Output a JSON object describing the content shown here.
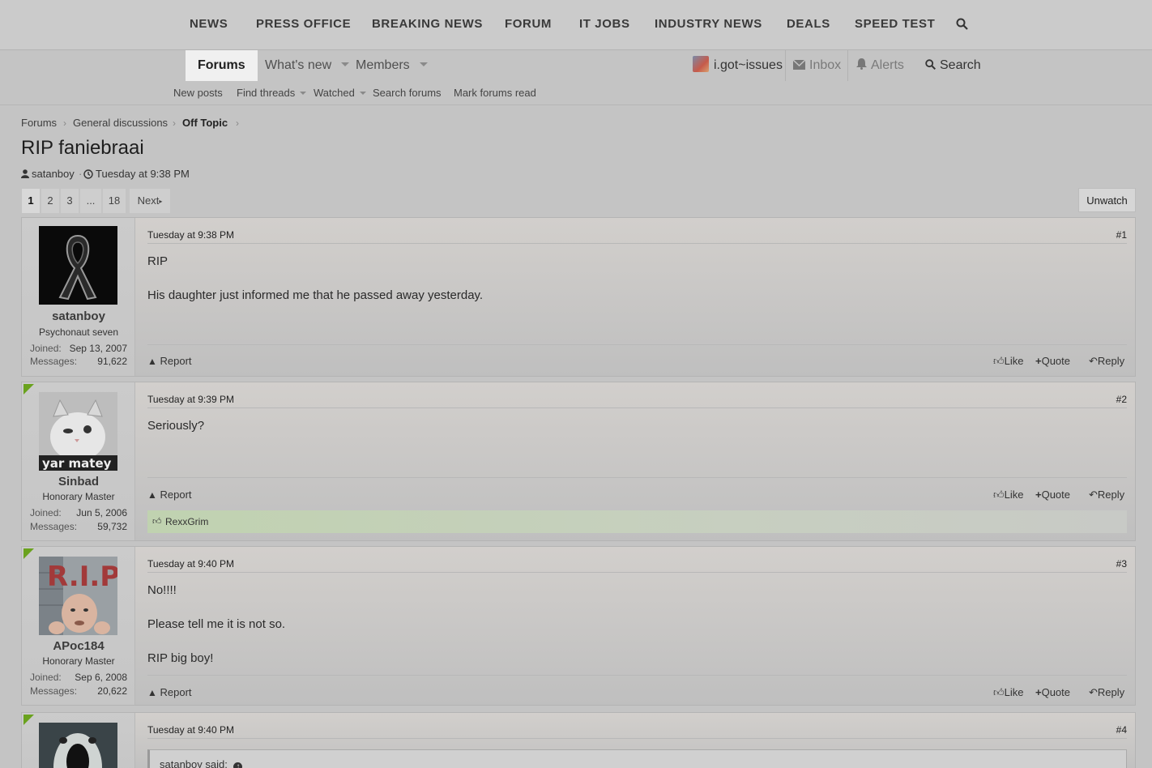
{
  "topnav": {
    "items": [
      "NEWS",
      "PRESS OFFICE",
      "BREAKING NEWS",
      "FORUM",
      "IT JOBS",
      "INDUSTRY NEWS",
      "DEALS",
      "SPEED TEST"
    ]
  },
  "subnav": {
    "tabs": [
      "Forums",
      "What's new",
      "Members"
    ],
    "user": "i.got~issues",
    "inbox": "Inbox",
    "alerts": "Alerts",
    "search": "Search",
    "subitems": [
      "New posts",
      "Find threads",
      "Watched",
      "Search forums",
      "Mark forums read"
    ]
  },
  "breadcrumb": [
    "Forums",
    "General discussions",
    "Off Topic"
  ],
  "thread": {
    "title": "RIP faniebraai",
    "author": "satanboy",
    "date": "Tuesday at 9:38 PM",
    "unwatch": "Unwatch"
  },
  "pagination": {
    "pages": [
      "1",
      "2",
      "3",
      "...",
      "18"
    ],
    "next": "Next"
  },
  "labels": {
    "joined": "Joined:",
    "messages": "Messages:",
    "report": "Report",
    "like": "Like",
    "quote": "Quote",
    "reply": "Reply"
  },
  "posts": [
    {
      "user": "satanboy",
      "title": "Psychonaut seven",
      "joined": "Sep 13, 2007",
      "messages": "91,622",
      "date": "Tuesday at 9:38 PM",
      "num": "#1",
      "lines": [
        "RIP",
        "His daughter just informed me that he passed away yesterday."
      ]
    },
    {
      "user": "Sinbad",
      "title": "Honorary Master",
      "joined": "Jun 5, 2006",
      "messages": "59,732",
      "date": "Tuesday at 9:39 PM",
      "num": "#2",
      "lines": [
        "Seriously?"
      ],
      "likes": "RexxGrim",
      "avatar_caption": "yar matey"
    },
    {
      "user": "APoc184",
      "title": "Honorary Master",
      "joined": "Sep 6, 2008",
      "messages": "20,622",
      "date": "Tuesday at 9:40 PM",
      "num": "#3",
      "lines": [
        "No!!!!",
        "Please tell me it is not so.",
        "RIP big boy!"
      ],
      "avatar_caption": "R.I.P"
    },
    {
      "date": "Tuesday at 9:40 PM",
      "num": "#4",
      "quote": "satanboy said:"
    }
  ],
  "colors": {
    "accent_flag": "#6aa21e",
    "like_bar": "#c0d2b0"
  }
}
